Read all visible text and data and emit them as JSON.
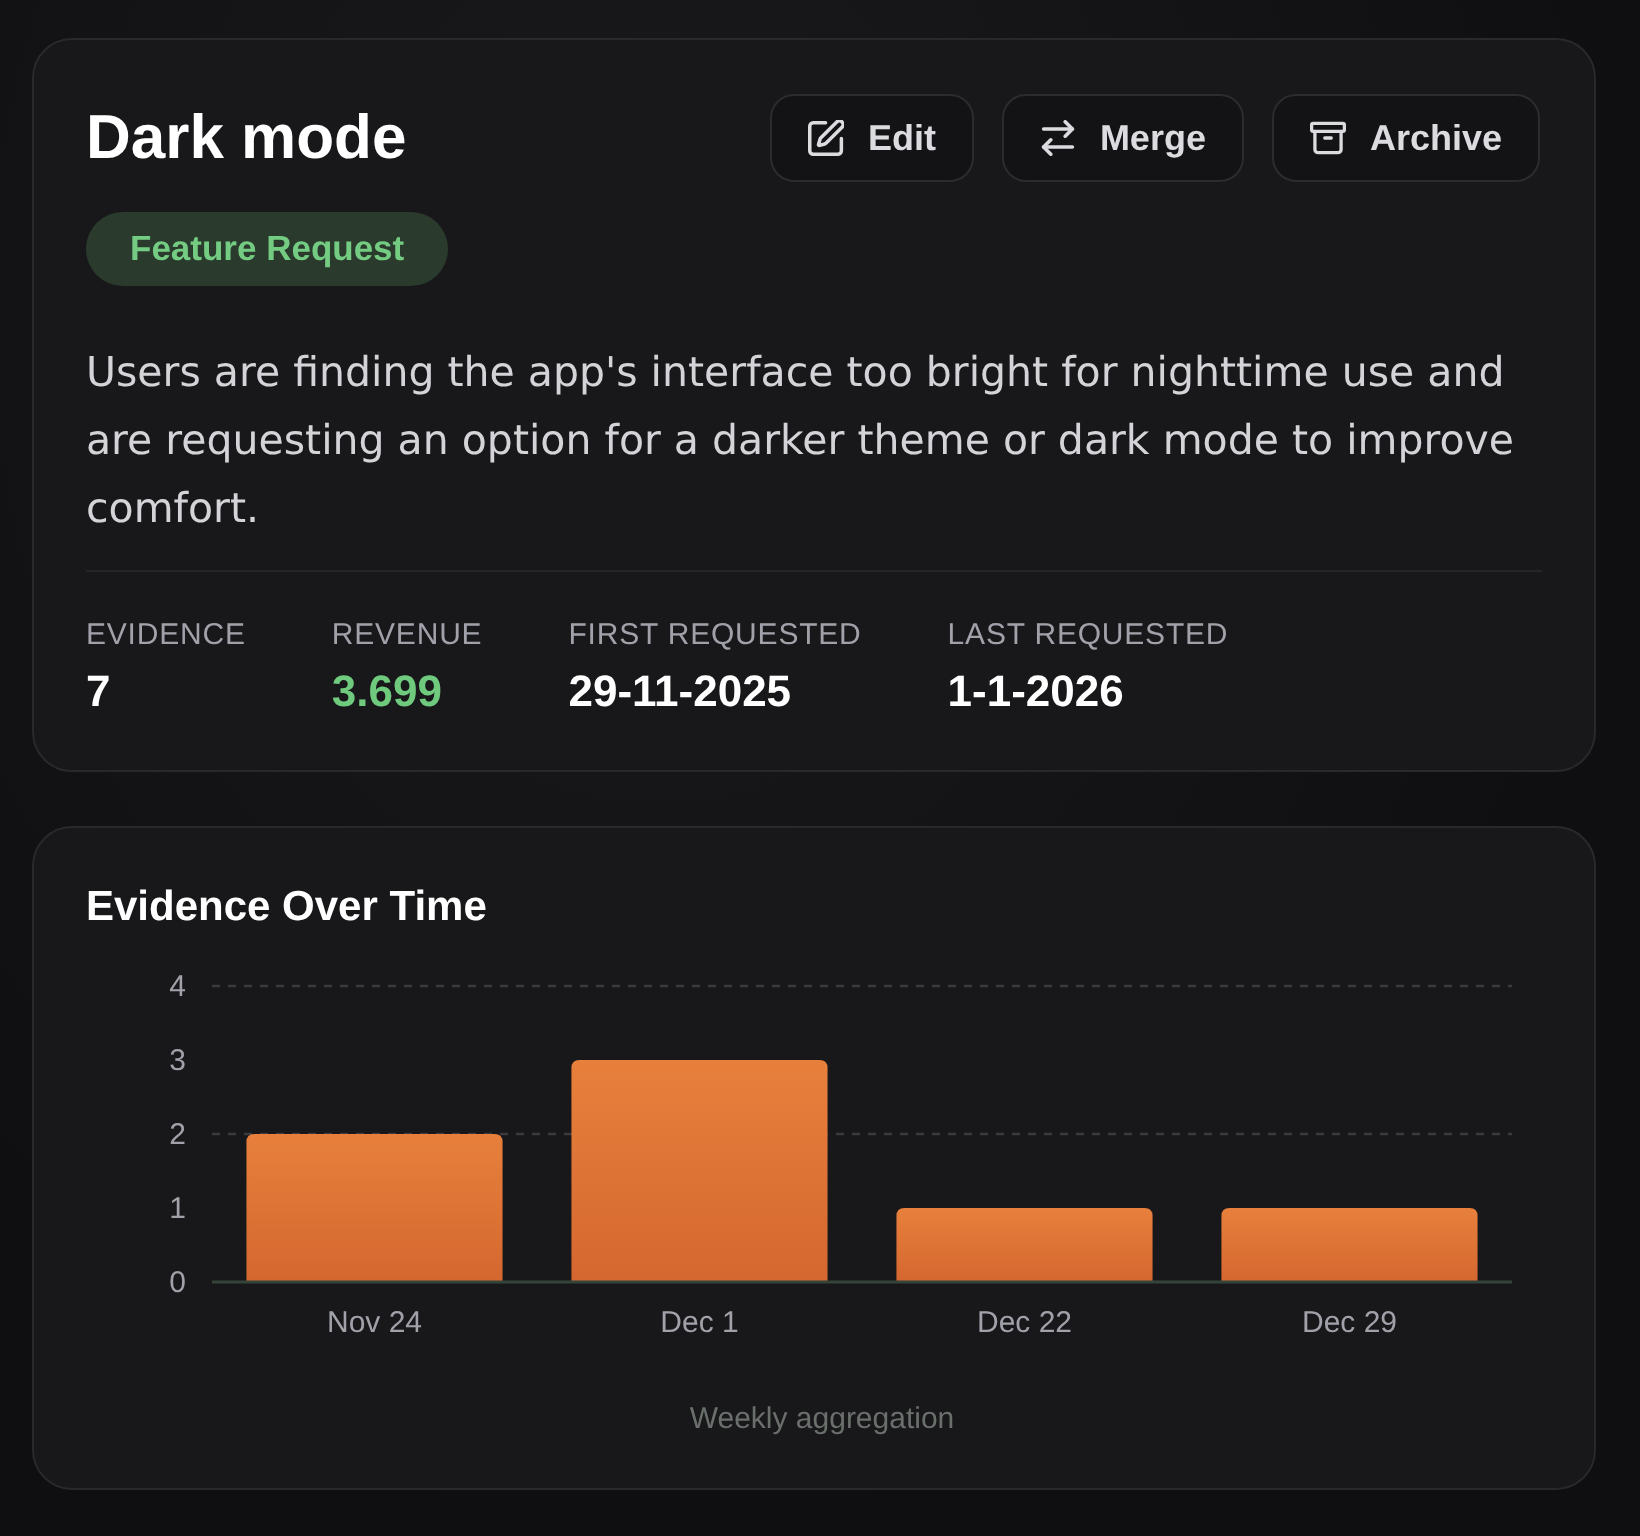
{
  "feature": {
    "title": "Dark mode",
    "actions": [
      {
        "kind": "edit",
        "label": "Edit"
      },
      {
        "kind": "merge",
        "label": "Merge"
      },
      {
        "kind": "archive",
        "label": "Archive"
      }
    ],
    "badge": "Feature Request",
    "description": "Users are finding the app's interface too bright for nighttime use and are requesting an option for a darker theme or dark mode to improve comfort.",
    "stats": [
      {
        "label": "EVIDENCE",
        "value": "7",
        "accent": false
      },
      {
        "label": "REVENUE",
        "value": "3.699",
        "accent": true
      },
      {
        "label": "FIRST REQUESTED",
        "value": "29-11-2025",
        "accent": false
      },
      {
        "label": "LAST REQUESTED",
        "value": "1-1-2026",
        "accent": false
      }
    ]
  },
  "chart_card": {
    "title": "Evidence Over Time",
    "chart_data": {
      "type": "bar",
      "xlabel": "Weekly aggregation",
      "categories": [
        "Nov 24",
        "Dec 1",
        "Dec 22",
        "Dec 29"
      ],
      "values": [
        2,
        3,
        1,
        1
      ],
      "ylim": [
        0,
        4
      ],
      "yticks": [
        0,
        1,
        2,
        3,
        4
      ]
    }
  }
}
